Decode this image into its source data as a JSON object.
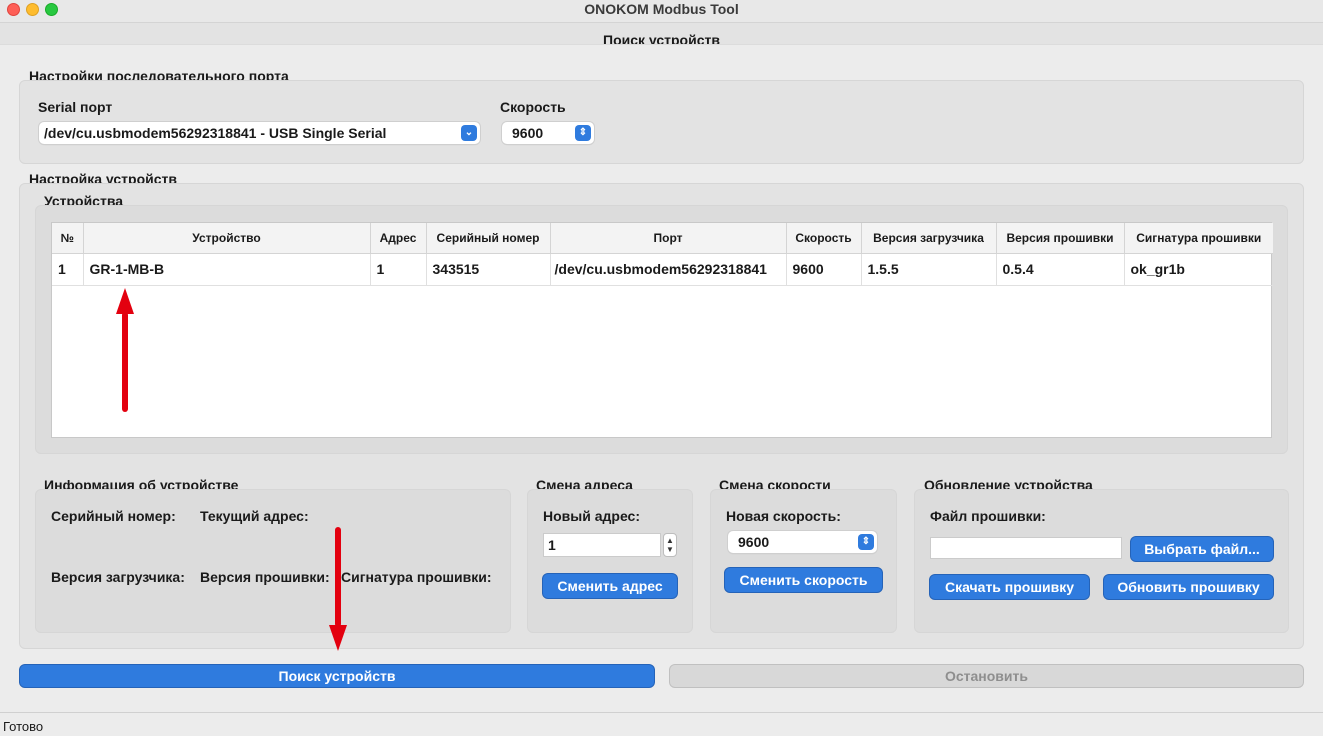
{
  "window": {
    "title": "ONOKOM Modbus Tool"
  },
  "tab": {
    "title": "Поиск устройств"
  },
  "serial_settings": {
    "section_title": "Настройки последовательного порта",
    "port_label": "Serial порт",
    "port_value": "/dev/cu.usbmodem56292318841 - USB Single Serial",
    "speed_label": "Скорость",
    "speed_value": "9600"
  },
  "devices_settings": {
    "section_title": "Настройка устройств",
    "devices_title": "Устройства",
    "table": {
      "headers": [
        "№",
        "Устройство",
        "Адрес",
        "Серийный номер",
        "Порт",
        "Скорость",
        "Версия загрузчика",
        "Версия прошивки",
        "Сигнатура прошивки"
      ],
      "rows": [
        [
          "1",
          "GR-1-MB-B",
          "1",
          "343515",
          "/dev/cu.usbmodem56292318841",
          "9600",
          "1.5.5",
          "0.5.4",
          "ok_gr1b"
        ]
      ]
    }
  },
  "device_info": {
    "title": "Информация об устройстве",
    "serial_label": "Серийный номер:",
    "address_label": "Текущий адрес:",
    "bootloader_label": "Версия загрузчика:",
    "firmware_label": "Версия прошивки:",
    "signature_label": "Сигнатура прошивки:"
  },
  "address_change": {
    "title": "Смена адреса",
    "new_address_label": "Новый адрес:",
    "new_address_value": "1",
    "button": "Сменить адрес"
  },
  "speed_change": {
    "title": "Смена скорости",
    "new_speed_label": "Новая скорость:",
    "new_speed_value": "9600",
    "button": "Сменить скорость"
  },
  "firmware_update": {
    "title": "Обновление устройства",
    "file_label": "Файл прошивки:",
    "file_value": "",
    "choose_button": "Выбрать файл...",
    "download_button": "Скачать прошивку",
    "update_button": "Обновить прошивку"
  },
  "actions": {
    "search_button": "Поиск устройств",
    "stop_button": "Остановить"
  },
  "status": {
    "text": "Готово"
  },
  "colors": {
    "accent": "#2f7bde",
    "annotation_arrow": "#e3000f"
  },
  "icons": {
    "combo_arrow": "chevron-updown-icon",
    "annotation": "red-arrow-icon"
  }
}
